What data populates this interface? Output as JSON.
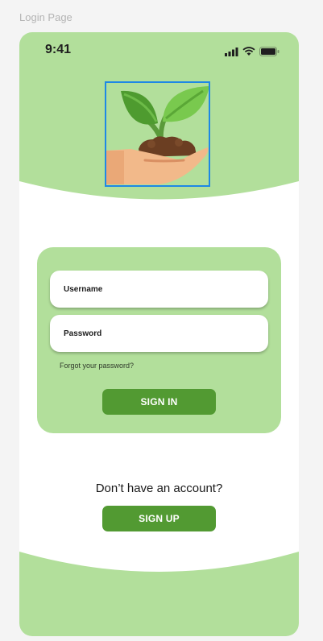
{
  "frame": {
    "label": "Login Page"
  },
  "status_bar": {
    "time": "9:41",
    "icons": [
      "signal-icon",
      "wifi-icon",
      "battery-icon"
    ]
  },
  "hero": {
    "logo_icon": "plant-in-hand-icon"
  },
  "form": {
    "username_placeholder": "Username",
    "password_placeholder": "Password",
    "forgot_link": "Forgot your password?",
    "signin_label": "SIGN IN"
  },
  "signup": {
    "prompt": "Don’t have an account?",
    "button_label": "SIGN UP"
  },
  "colors": {
    "accent_light": "#b2df9b",
    "accent_dark": "#529a32",
    "selection_border": "#1e88e5"
  }
}
